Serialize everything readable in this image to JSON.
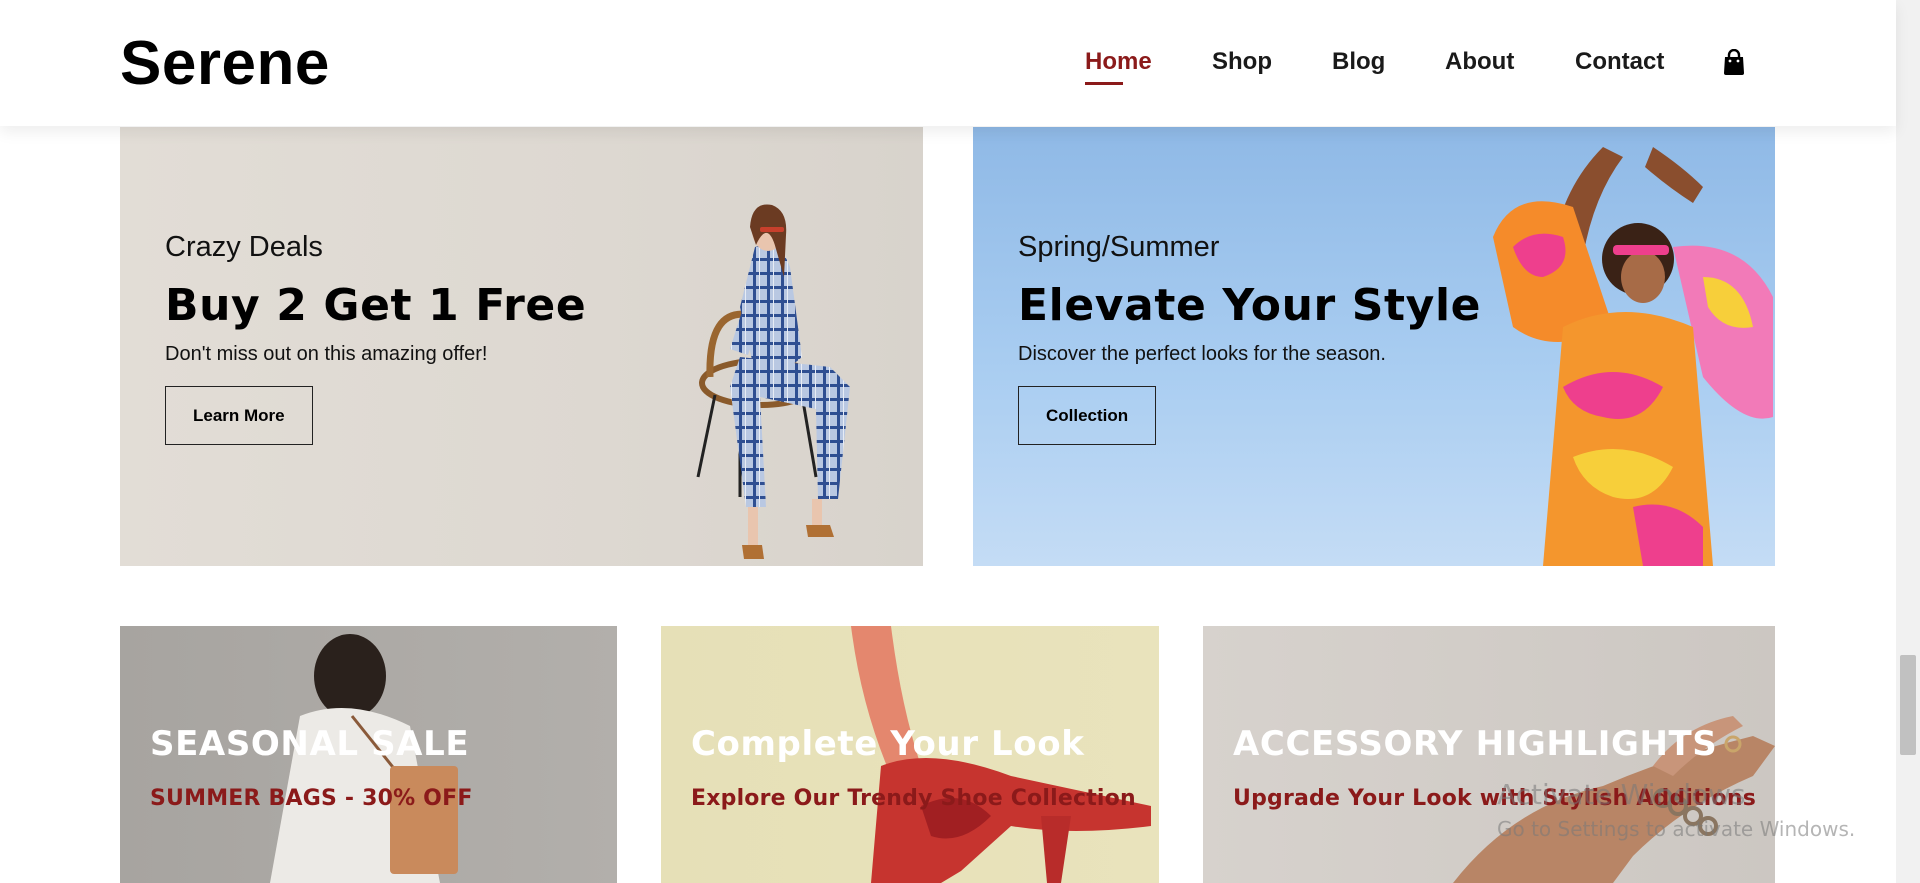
{
  "header": {
    "logo": "Serene",
    "nav": [
      {
        "label": "Home",
        "active": true
      },
      {
        "label": "Shop",
        "active": false
      },
      {
        "label": "Blog",
        "active": false
      },
      {
        "label": "About",
        "active": false
      },
      {
        "label": "Contact",
        "active": false
      }
    ],
    "cart_icon": "shopping-bag-icon"
  },
  "banners": [
    {
      "kicker": "Crazy Deals",
      "title": "Buy 2 Get 1 Free",
      "subtitle": "Don't miss out on this amazing offer!",
      "button": "Learn More"
    },
    {
      "kicker": "Spring/Summer",
      "title": "Elevate Your Style",
      "subtitle": "Discover the perfect looks for the season.",
      "button": "Collection"
    }
  ],
  "cards": [
    {
      "title": "SEASONAL SALE",
      "subtitle": "SUMMER BAGS - 30% OFF"
    },
    {
      "title": "Complete Your Look",
      "subtitle": "Explore Our Trendy Shoe Collection"
    },
    {
      "title": "ACCESSORY HIGHLIGHTS",
      "subtitle": "Upgrade Your Look with Stylish Additions"
    }
  ],
  "watermark": {
    "title": "Activate Windows",
    "subtitle": "Go to Settings to activate Windows."
  },
  "colors": {
    "accent": "#8b1a1a",
    "banner_1_bg": "#dfdad3",
    "banner_2_bg": "#a9cdf1"
  }
}
